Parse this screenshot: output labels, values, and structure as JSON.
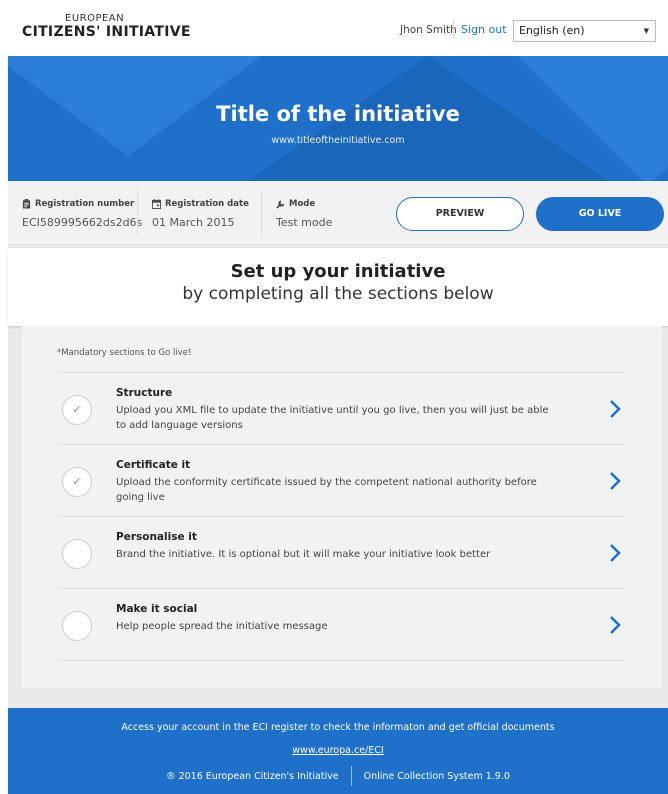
{
  "header": {
    "logo_top": "EUROPEAN",
    "logo_main": "CITIZENS' INITIATIVE",
    "user_name": "Jhon Smith",
    "sign_out": "Sign out",
    "language": "English (en)"
  },
  "banner": {
    "title": "Title of the initiative",
    "url": "www.titleoftheinitiative.com"
  },
  "info": {
    "registration_number_label": "Registration number",
    "registration_number": "ECI589995662ds2d6s",
    "registration_date_label": "Registration date",
    "registration_date": "01 March 2015",
    "mode_label": "Mode",
    "mode": "Test mode",
    "preview_label": "PREVIEW",
    "golive_label": "GO LIVE"
  },
  "setup": {
    "title": "Set up your initiative",
    "subtitle": "by completing all the sections below"
  },
  "sections": {
    "mandatory_note": "*Mandatory sections to Go live!",
    "items": [
      {
        "title": "Structure",
        "description": "Upload you XML file to update the initiative until you go live, then you will just be able to add language versions",
        "completed": true
      },
      {
        "title": "Certificate it",
        "description": "Upload the conformity certificate issued by the competent national authority before going live",
        "completed": true
      },
      {
        "title": "Personalise it",
        "description": "Brand the initiative. It is optional but it will make your initiative look better",
        "completed": false
      },
      {
        "title": "Make it social",
        "description": "Help people spread the initiative message",
        "completed": false
      }
    ]
  },
  "footer": {
    "message": "Access your account in the ECI register to check the informaton and get official documents",
    "link": "www.europa.ce/ECI",
    "copyright": "® 2016 European Citizen's Initiative",
    "version": "Online Collection System 1.9.0"
  },
  "colors": {
    "primary": "#1f70c9",
    "background": "#e9e9e9"
  }
}
